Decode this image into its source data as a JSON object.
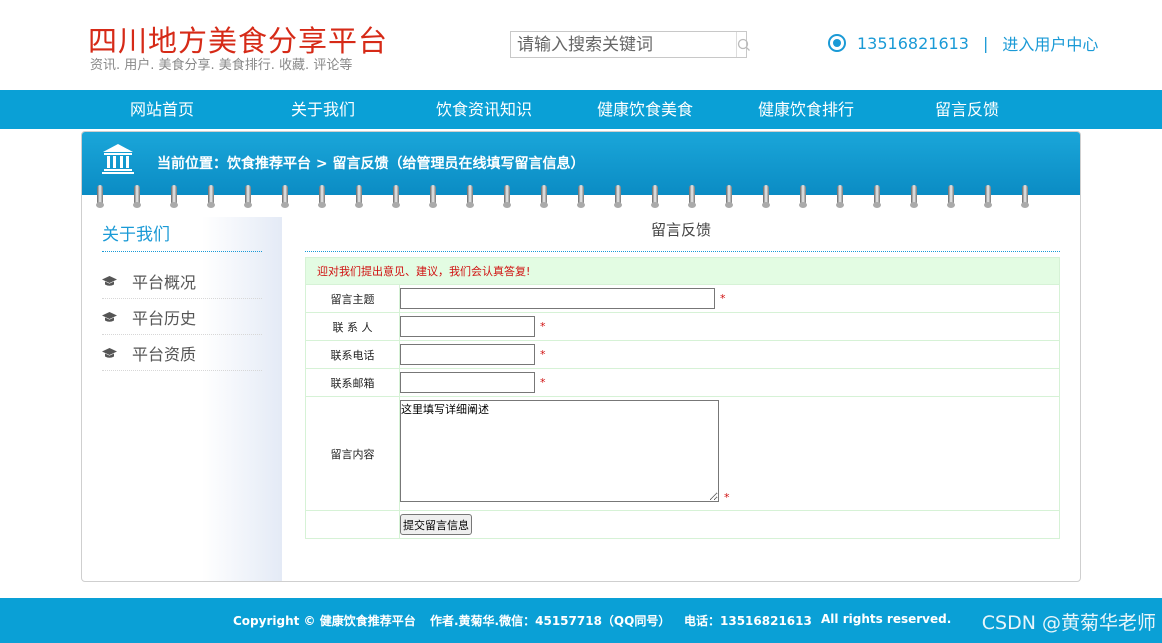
{
  "header": {
    "title": "四川地方美食分享平台",
    "subtitle": "资讯. 用户. 美食分享. 美食排行. 收藏. 评论等",
    "search_placeholder": "请输入搜索关键词",
    "phone": "13516821613",
    "separator": "|",
    "user_center": "进入用户中心"
  },
  "nav": {
    "items": [
      "网站首页",
      "关于我们",
      "饮食资讯知识",
      "健康饮食美食",
      "健康饮食排行",
      "留言反馈"
    ]
  },
  "breadcrumb": "当前位置：饮食推荐平台 > 留言反馈（给管理员在线填写留言信息）",
  "sidebar": {
    "title": "关于我们",
    "items": [
      "平台概况",
      "平台历史",
      "平台资质"
    ]
  },
  "content": {
    "title": "留言反馈",
    "notice": "迎对我们提出意见、建议，我们会认真答复!",
    "fields": {
      "subject": "留言主题",
      "contact": "联 系 人",
      "phone": "联系电话",
      "email": "联系邮箱",
      "message": "留言内容"
    },
    "message_value": "这里填写详细阐述",
    "required_mark": "*",
    "submit": "提交留言信息"
  },
  "footer": {
    "copyright": "Copyright © 健康饮食推荐平台",
    "author": "作者.黄菊华.微信：45157718（QQ同号）",
    "tel": "电话：13516821613",
    "rights": "All rights reserved.",
    "watermark": "CSDN @黄菊华老师"
  },
  "colors": {
    "brand_red": "#d62a17",
    "accent_blue": "#0aa0d6",
    "notice_bg": "#e3fce3"
  }
}
